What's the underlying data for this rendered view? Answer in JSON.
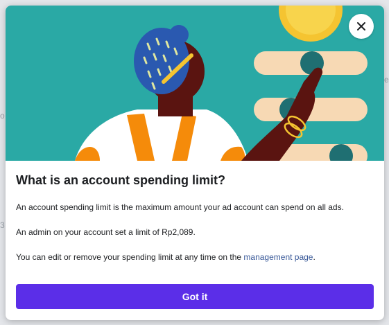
{
  "background": {
    "fragments": [
      "o",
      "3",
      "e"
    ]
  },
  "dialog": {
    "title": "What is an account spending limit?",
    "paragraph1": "An account spending limit is the maximum amount your ad account can spend on all ads.",
    "paragraph2": "An admin on your account set a limit of Rp2,089.",
    "paragraph3_prefix": "You can edit or remove your spending limit at any time on the ",
    "paragraph3_link": "management page",
    "paragraph3_suffix": ".",
    "primary_button": "Got it",
    "close_icon": "close-icon"
  },
  "colors": {
    "hero_bg": "#2aa9a5",
    "primary": "#5b2ee8",
    "link": "#385898"
  }
}
